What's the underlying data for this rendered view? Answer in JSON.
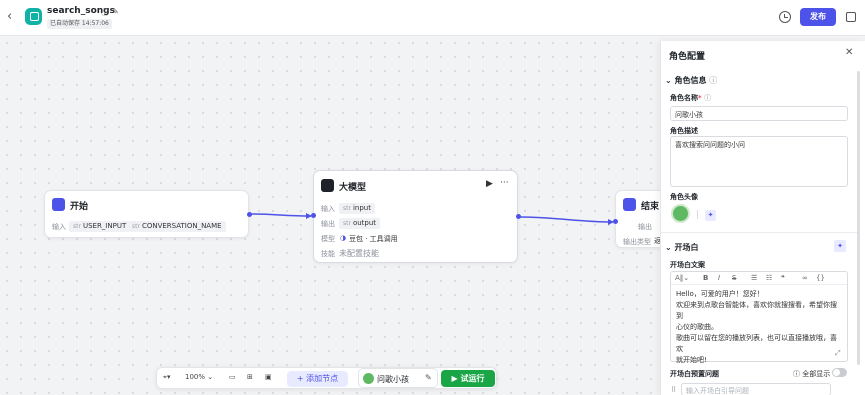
{
  "header": {
    "title": "search_songs",
    "saved_status": "已自动保存 14:57:06",
    "publish_label": "发布"
  },
  "nodes": {
    "start": {
      "title": "开始",
      "input_label": "输入",
      "params": [
        "USER_INPUT",
        "CONVERSATION_NAME"
      ],
      "param_prefix": "str"
    },
    "llm": {
      "title": "大模型",
      "input_label": "输入",
      "input_param": "input",
      "output_label": "输出",
      "output_param": "output",
      "model_label": "模型",
      "model_value": "豆包 · 工具调用",
      "skill_label": "技能",
      "skill_value": "未配置技能",
      "param_prefix": "str"
    },
    "end": {
      "title": "结束",
      "output_label": "输出",
      "output_type_label": "输出类型",
      "output_type_value": "返"
    }
  },
  "panel": {
    "title": "角色配置",
    "role_info_label": "角色信息",
    "role_name_label": "角色名称",
    "role_name_value": "问歌小孩",
    "role_desc_label": "角色描述",
    "role_desc_value": "喜欢搜索问问题的小问",
    "avatar_label": "角色头像",
    "opening_label": "开场白",
    "opening_text_label": "开场白文案",
    "opening_text_lines": [
      "Hello，可爱的用户！您好！",
      "欢迎来到点歌台智能体，喜欢你就搜搜看，希望你搜到",
      "心仪的歌曲。",
      "歌曲可以留在您的播放列表，也可以直接播放哦，喜欢",
      "就开始吧!"
    ],
    "preset_label": "开场白预置问题",
    "show_all_label": "全部显示",
    "preset_placeholder": "输入开场白引导问题"
  },
  "toolbar": {
    "zoom": "100%",
    "add_node_label": "添加节点",
    "role_name": "问歌小孩",
    "run_label": "试运行"
  },
  "colors": {
    "accent": "#4d53e8",
    "run": "#1aa546",
    "app_icon": "#0fb2a4"
  }
}
